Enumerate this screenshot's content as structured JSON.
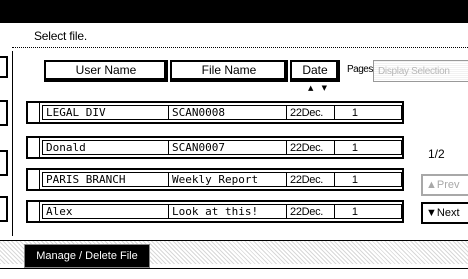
{
  "prompt": "Select file.",
  "columns": {
    "user_name": "User Name",
    "file_name": "File Name",
    "date": "Date",
    "pages": "Pages",
    "display_selection": "Display Selection"
  },
  "sort_indicator": "▲ ▼",
  "files": [
    {
      "user": "LEGAL DIV",
      "file": "SCAN0008",
      "date": "22Dec.",
      "pages": "1"
    },
    {
      "user": "Donald",
      "file": "SCAN0007",
      "date": "22Dec.",
      "pages": "1"
    },
    {
      "user": "PARIS BRANCH",
      "file": "Weekly Report",
      "date": "22Dec.",
      "pages": "1"
    },
    {
      "user": "Alex",
      "file": "Look at this!",
      "date": "22Dec.",
      "pages": "1"
    }
  ],
  "pagination": {
    "indicator": "1/2",
    "prev_label": "▲Prev",
    "next_label": "▼Next"
  },
  "footer": {
    "manage_label": "Manage / Delete File"
  }
}
